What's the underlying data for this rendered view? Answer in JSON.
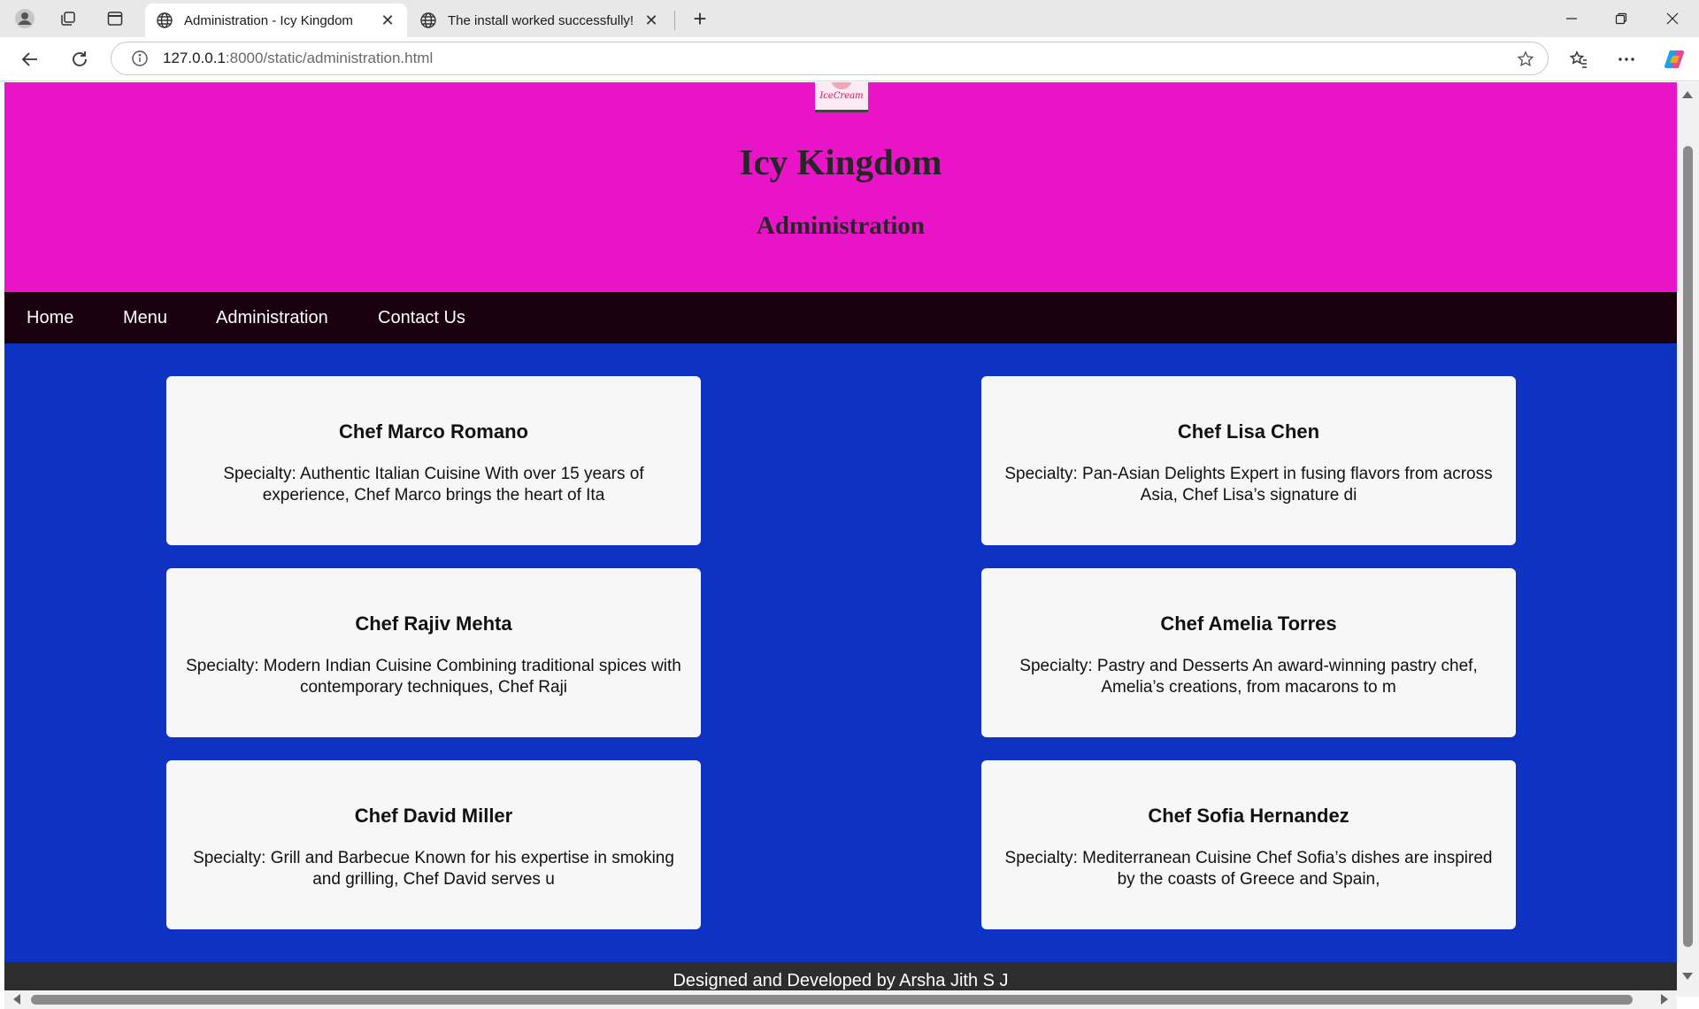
{
  "browser": {
    "tabs": [
      {
        "title": "Administration - Icy Kingdom",
        "active": true
      },
      {
        "title": "The install worked successfully! Co",
        "active": false
      }
    ],
    "address": {
      "host": "127.0.0.1",
      "rest": ":8000/static/administration.html"
    }
  },
  "site": {
    "logo_text": "IceCream",
    "title": "Icy Kingdom",
    "subtitle": "Administration",
    "nav": [
      "Home",
      "Menu",
      "Administration",
      "Contact Us"
    ],
    "chefs": [
      {
        "name": "Chef Marco Romano",
        "desc": "Specialty: Authentic Italian Cuisine With over 15 years of experience, Chef Marco brings the heart of Ita"
      },
      {
        "name": "Chef Lisa Chen",
        "desc": "Specialty: Pan-Asian Delights Expert in fusing flavors from across Asia, Chef Lisa’s signature di"
      },
      {
        "name": "Chef Rajiv Mehta",
        "desc": "Specialty: Modern Indian Cuisine Combining traditional spices with contemporary techniques, Chef Raji"
      },
      {
        "name": "Chef Amelia Torres",
        "desc": "Specialty: Pastry and Desserts An award-winning pastry chef, Amelia’s creations, from macarons to m"
      },
      {
        "name": "Chef David Miller",
        "desc": "Specialty: Grill and Barbecue Known for his expertise in smoking and grilling, Chef David serves u"
      },
      {
        "name": "Chef Sofia Hernandez",
        "desc": "Specialty: Mediterranean Cuisine Chef Sofia’s dishes are inspired by the coasts of Greece and Spain,"
      }
    ],
    "footer": "Designed and Developed by Arsha Jith S J"
  },
  "colors": {
    "header_bg": "#e914c8",
    "nav_bg": "#1a000e",
    "body_bg": "#0e33c2",
    "card_bg": "#f7f7f7",
    "footer_bg": "#2d2d2d"
  }
}
